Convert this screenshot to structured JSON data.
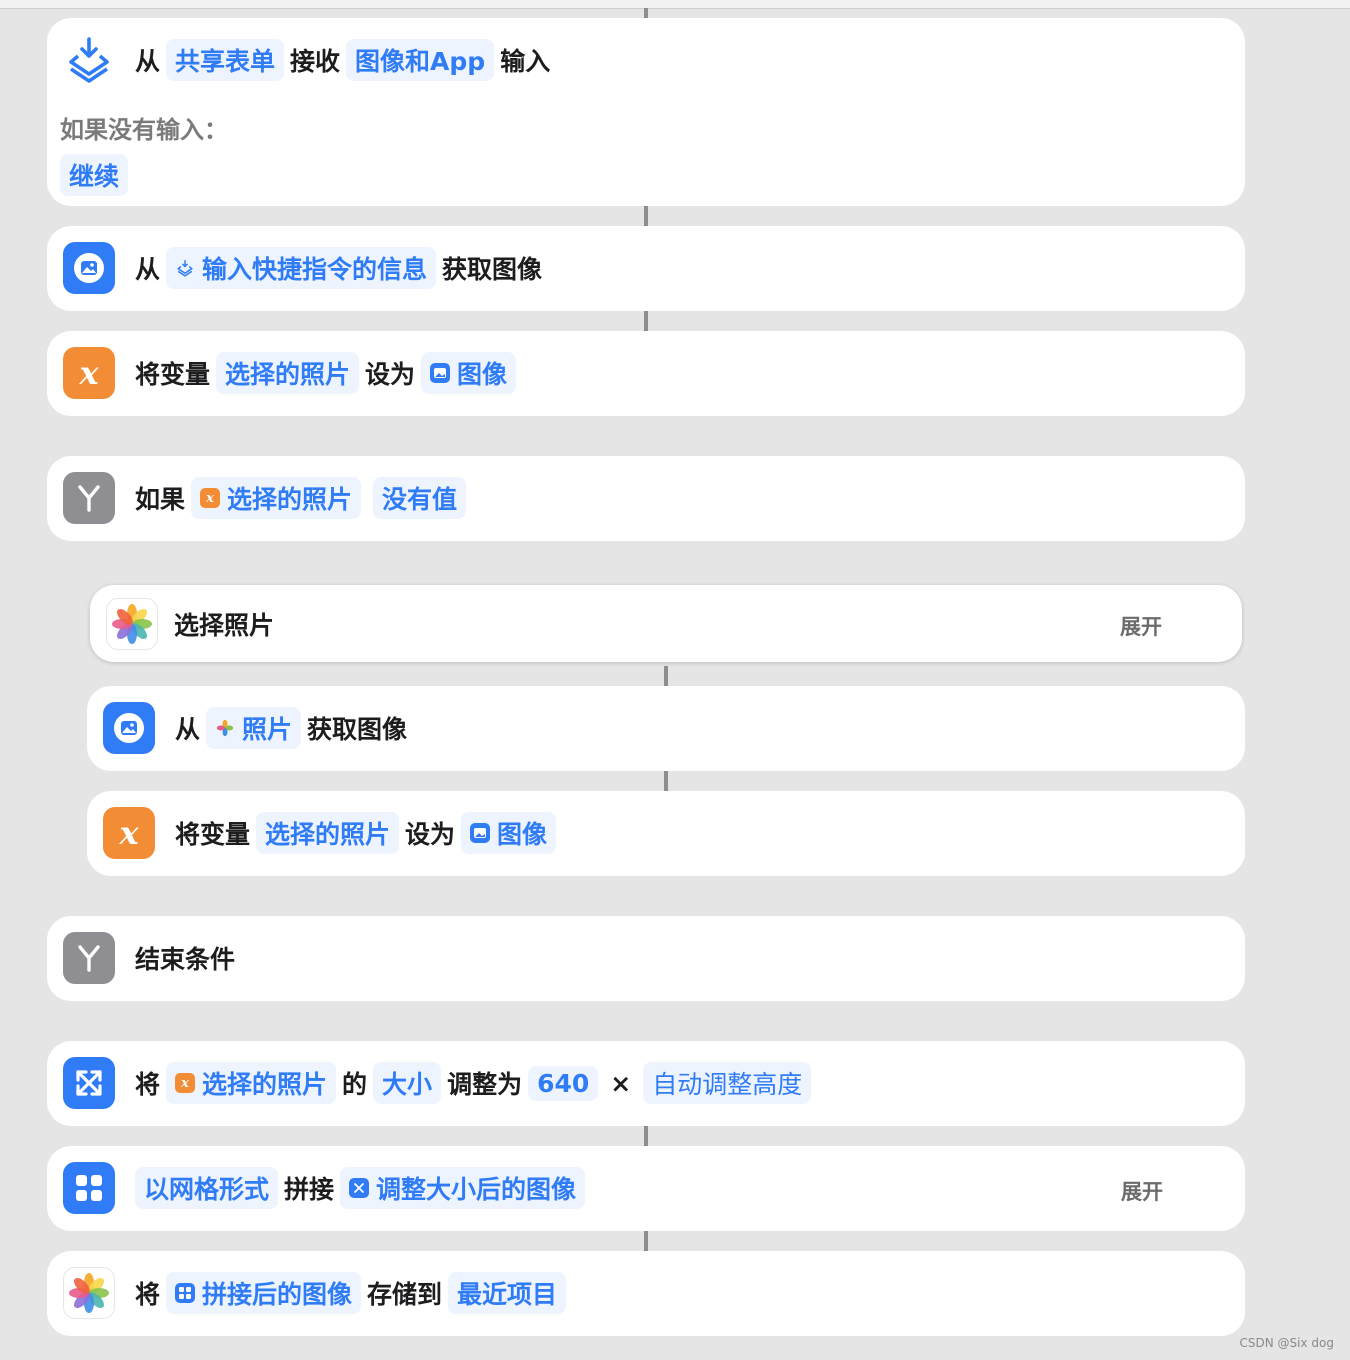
{
  "actions": [
    {
      "prefix": "从",
      "token1": "共享表单",
      "mid": "接收",
      "token2": "图像和App",
      "suffix": "输入",
      "no_input_label": "如果没有输入：",
      "no_input_value": "继续"
    },
    {
      "prefix": "从",
      "token": "输入快捷指令的信息",
      "suffix": "获取图像"
    },
    {
      "prefix": "将变量",
      "token": "选择的照片",
      "mid": "设为",
      "token2": "图像"
    },
    {
      "prefix": "如果",
      "token": "选择的照片",
      "token2": "没有值"
    },
    {
      "label": "选择照片",
      "expand": "展开"
    },
    {
      "prefix": "从",
      "token": "照片",
      "suffix": "获取图像"
    },
    {
      "prefix": "将变量",
      "token": "选择的照片",
      "mid": "设为",
      "token2": "图像"
    },
    {
      "label": "结束条件"
    },
    {
      "prefix": "将",
      "token": "选择的照片",
      "mid1": "的",
      "token2": "大小",
      "mid2": "调整为",
      "token3": "640",
      "times": "×",
      "token4": "自动调整高度"
    },
    {
      "token": "以网格形式",
      "mid": "拼接",
      "token2": "调整大小后的图像",
      "expand": "展开"
    },
    {
      "prefix": "将",
      "token": "拼接后的图像",
      "mid": "存储到",
      "token2": "最近项目"
    }
  ],
  "icons": {
    "share_sheet": "share-sheet-icon",
    "image": "image-icon",
    "variable": "variable-x-icon",
    "condition": "branch-icon",
    "photos": "photos-app-icon",
    "resize": "resize-icon",
    "grid": "grid-icon"
  },
  "colors": {
    "accent": "#2f7cf6",
    "variable": "#f28c35",
    "condition": "#8e8e93",
    "background": "#e5e5e5"
  },
  "watermark": "CSDN @Six dog"
}
